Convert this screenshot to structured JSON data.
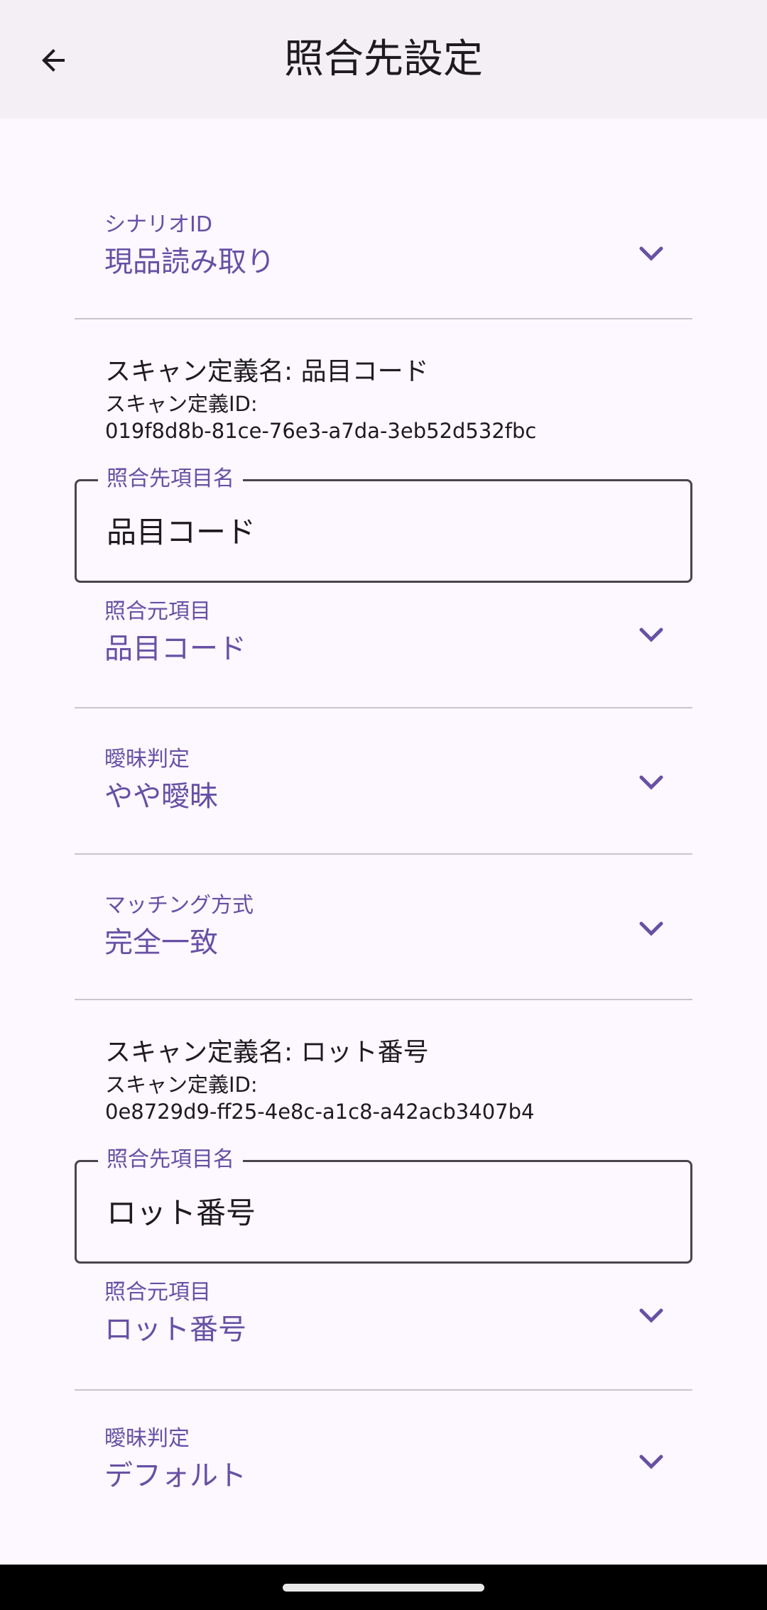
{
  "app_bar": {
    "title": "照合先設定"
  },
  "scenario": {
    "label": "シナリオID",
    "value": "現品読み取り"
  },
  "sections": [
    {
      "scan_name": "スキャン定義名: 品目コード",
      "scan_id_label": "スキャン定義ID:",
      "scan_id": "019f8d8b-81ce-76e3-a7da-3eb52d532fbc",
      "target_item": {
        "label": "照合先項目名",
        "value": "品目コード"
      },
      "source_item": {
        "label": "照合元項目",
        "value": "品目コード"
      },
      "ambiguity": {
        "label": "曖昧判定",
        "value": "やや曖昧"
      },
      "matching": {
        "label": "マッチング方式",
        "value": "完全一致"
      }
    },
    {
      "scan_name": "スキャン定義名: ロット番号",
      "scan_id_label": "スキャン定義ID:",
      "scan_id": "0e8729d9-ff25-4e8c-a1c8-a42acb3407b4",
      "target_item": {
        "label": "照合先項目名",
        "value": "ロット番号"
      },
      "source_item": {
        "label": "照合元項目",
        "value": "ロット番号"
      },
      "ambiguity": {
        "label": "曖昧判定",
        "value": "デフォルト"
      }
    }
  ],
  "icons": {
    "back": "arrow-back-icon",
    "dropdown": "chevron-down-icon"
  },
  "colors": {
    "accent": "#6750a4",
    "background": "#fdf7ff",
    "app_bar": "#f3eff4"
  }
}
